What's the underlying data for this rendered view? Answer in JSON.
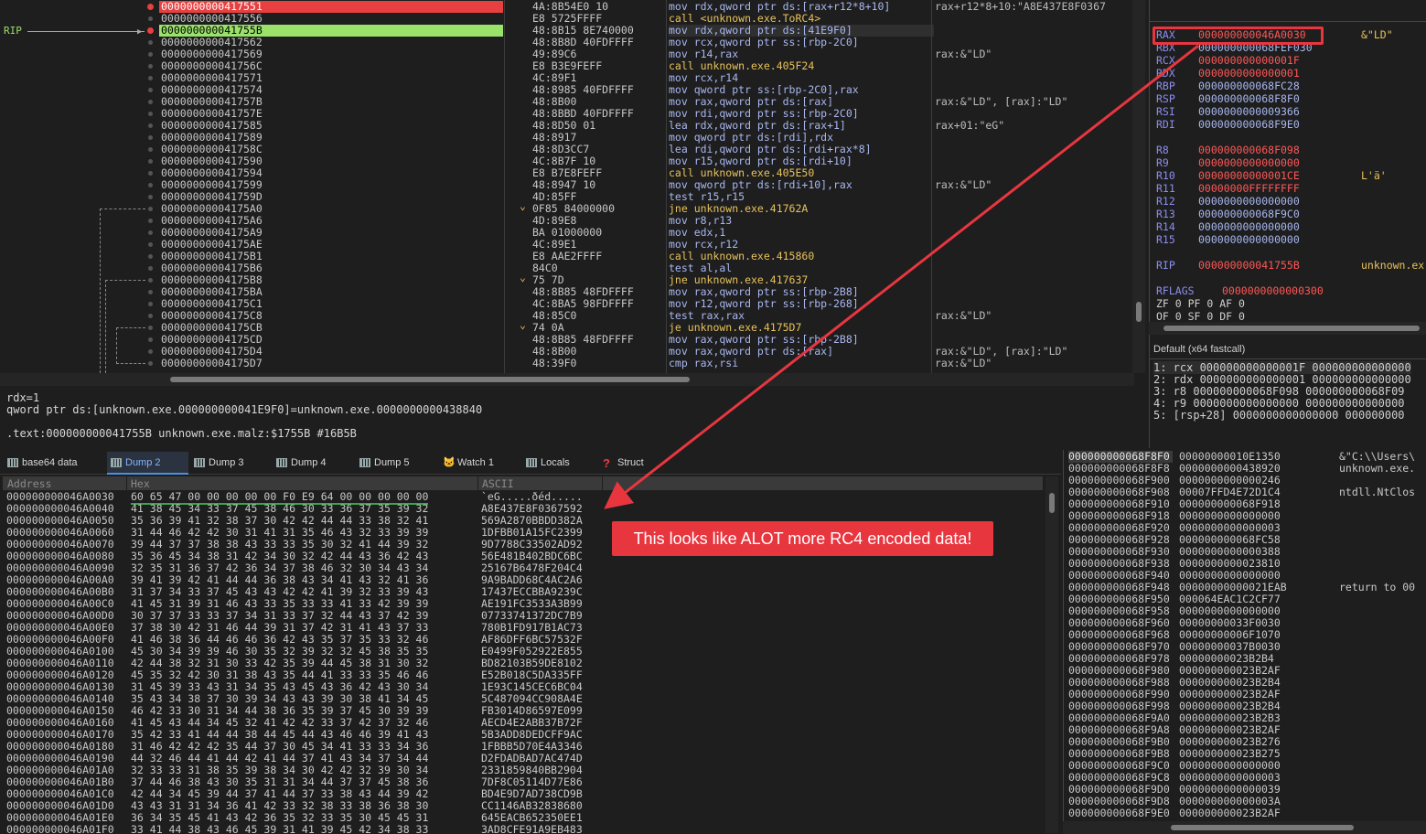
{
  "disasm": {
    "rip_label": "RIP",
    "rows": [
      {
        "addr": "0000000000417551",
        "bytes": "4A:8B54E0 10",
        "asm": "mov rdx,qword ptr ds:[rax+r12*8+10]",
        "comment": "rax+r12*8+10:\"A8E437E8F0367",
        "kind": "norm",
        "hl": "red"
      },
      {
        "addr": "0000000000417556",
        "bytes": "E8 5725FFFF",
        "asm": "call <unknown.exe.ToRC4>",
        "comment": "",
        "kind": "call"
      },
      {
        "addr": "000000000041755B",
        "bytes": "48:8B15 8E740000",
        "asm": "mov rdx,qword ptr ds:[41E9F0]",
        "comment": "",
        "kind": "norm",
        "hl": "green",
        "sel": true
      },
      {
        "addr": "0000000000417562",
        "bytes": "48:8B8D 40FDFFFF",
        "asm": "mov rcx,qword ptr ss:[rbp-2C0]",
        "comment": "",
        "kind": "norm"
      },
      {
        "addr": "0000000000417569",
        "bytes": "49:89C6",
        "asm": "mov r14,rax",
        "comment": "rax:&\"LD\"",
        "kind": "norm"
      },
      {
        "addr": "000000000041756C",
        "bytes": "E8 B3E9FEFF",
        "asm": "call unknown.exe.405F24",
        "comment": "",
        "kind": "call"
      },
      {
        "addr": "0000000000417571",
        "bytes": "4C:89F1",
        "asm": "mov rcx,r14",
        "comment": "",
        "kind": "norm"
      },
      {
        "addr": "0000000000417574",
        "bytes": "48:8985 40FDFFFF",
        "asm": "mov qword ptr ss:[rbp-2C0],rax",
        "comment": "",
        "kind": "norm"
      },
      {
        "addr": "000000000041757B",
        "bytes": "48:8B00",
        "asm": "mov rax,qword ptr ds:[rax]",
        "comment": "rax:&\"LD\", [rax]:\"LD\"",
        "kind": "norm"
      },
      {
        "addr": "000000000041757E",
        "bytes": "48:8BBD 40FDFFFF",
        "asm": "mov rdi,qword ptr ss:[rbp-2C0]",
        "comment": "",
        "kind": "norm"
      },
      {
        "addr": "0000000000417585",
        "bytes": "48:8D50 01",
        "asm": "lea rdx,qword ptr ds:[rax+1]",
        "comment": "rax+01:\"eG\"",
        "kind": "norm"
      },
      {
        "addr": "0000000000417589",
        "bytes": "48:8917",
        "asm": "mov qword ptr ds:[rdi],rdx",
        "comment": "",
        "kind": "norm"
      },
      {
        "addr": "000000000041758C",
        "bytes": "48:8D3CC7",
        "asm": "lea rdi,qword ptr ds:[rdi+rax*8]",
        "comment": "",
        "kind": "norm"
      },
      {
        "addr": "0000000000417590",
        "bytes": "4C:8B7F 10",
        "asm": "mov r15,qword ptr ds:[rdi+10]",
        "comment": "",
        "kind": "norm"
      },
      {
        "addr": "0000000000417594",
        "bytes": "E8 B7E8FEFF",
        "asm": "call unknown.exe.405E50",
        "comment": "",
        "kind": "call"
      },
      {
        "addr": "0000000000417599",
        "bytes": "48:8947 10",
        "asm": "mov qword ptr ds:[rdi+10],rax",
        "comment": "rax:&\"LD\"",
        "kind": "norm"
      },
      {
        "addr": "000000000041759D",
        "bytes": "4D:85FF",
        "asm": "test r15,r15",
        "comment": "",
        "kind": "norm"
      },
      {
        "addr": "00000000004175A0",
        "bytes": "0F85 84000000",
        "asm": "jne unknown.exe.41762A",
        "comment": "",
        "kind": "jmp",
        "mark": "v"
      },
      {
        "addr": "00000000004175A6",
        "bytes": "4D:89E8",
        "asm": "mov r8,r13",
        "comment": "",
        "kind": "norm"
      },
      {
        "addr": "00000000004175A9",
        "bytes": "BA 01000000",
        "asm": "mov edx,1",
        "comment": "",
        "kind": "norm"
      },
      {
        "addr": "00000000004175AE",
        "bytes": "4C:89E1",
        "asm": "mov rcx,r12",
        "comment": "",
        "kind": "norm"
      },
      {
        "addr": "00000000004175B1",
        "bytes": "E8 AAE2FFFF",
        "asm": "call unknown.exe.415860",
        "comment": "",
        "kind": "call"
      },
      {
        "addr": "00000000004175B6",
        "bytes": "84C0",
        "asm": "test al,al",
        "comment": "",
        "kind": "norm"
      },
      {
        "addr": "00000000004175B8",
        "bytes": "75 7D",
        "asm": "jne unknown.exe.417637",
        "comment": "",
        "kind": "jmp",
        "mark": "v"
      },
      {
        "addr": "00000000004175BA",
        "bytes": "48:8B85 48FDFFFF",
        "asm": "mov rax,qword ptr ss:[rbp-2B8]",
        "comment": "",
        "kind": "norm"
      },
      {
        "addr": "00000000004175C1",
        "bytes": "4C:8BA5 98FDFFFF",
        "asm": "mov r12,qword ptr ss:[rbp-268]",
        "comment": "",
        "kind": "norm"
      },
      {
        "addr": "00000000004175C8",
        "bytes": "48:85C0",
        "asm": "test rax,rax",
        "comment": "rax:&\"LD\"",
        "kind": "norm"
      },
      {
        "addr": "00000000004175CB",
        "bytes": "74 0A",
        "asm": "je unknown.exe.4175D7",
        "comment": "",
        "kind": "jmp",
        "mark": "v"
      },
      {
        "addr": "00000000004175CD",
        "bytes": "48:8B85 48FDFFFF",
        "asm": "mov rax,qword ptr ss:[rbp-2B8]",
        "comment": "",
        "kind": "norm"
      },
      {
        "addr": "00000000004175D4",
        "bytes": "48:8B00",
        "asm": "mov rax,qword ptr ds:[rax]",
        "comment": "rax:&\"LD\", [rax]:\"LD\"",
        "kind": "norm"
      },
      {
        "addr": "00000000004175D7",
        "bytes": "48:39F0",
        "asm": "cmp rax,rsi",
        "comment": "rax:&\"LD\"",
        "kind": "norm"
      }
    ]
  },
  "info": {
    "line1": "rdx=1",
    "line2": "qword ptr ds:[unknown.exe.000000000041E9F0]=unknown.exe.0000000000438840",
    "line3": ".text:000000000041755B unknown.exe.malz:$1755B #16B5B"
  },
  "registers": {
    "gp": [
      {
        "name": "RAX",
        "value": "000000000046A0030",
        "comment": "&\"LD\"",
        "changed": true
      },
      {
        "name": "RBX",
        "value": "000000000068FEF030",
        "comment": "",
        "changed": false
      },
      {
        "name": "RCX",
        "value": "000000000000001F",
        "comment": "",
        "changed": true
      },
      {
        "name": "RDX",
        "value": "0000000000000001",
        "comment": "",
        "changed": true
      },
      {
        "name": "RBP",
        "value": "000000000068FC28",
        "comment": "",
        "changed": false
      },
      {
        "name": "RSP",
        "value": "000000000068F8F0",
        "comment": "",
        "changed": false
      },
      {
        "name": "RSI",
        "value": "0000000000009366",
        "comment": "",
        "changed": false
      },
      {
        "name": "RDI",
        "value": "000000000068F9E0",
        "comment": "",
        "changed": false
      }
    ],
    "ext": [
      {
        "name": "R8",
        "value": "000000000068F098",
        "comment": "",
        "changed": true
      },
      {
        "name": "R9",
        "value": "0000000000000000",
        "comment": "",
        "changed": true
      },
      {
        "name": "R10",
        "value": "00000000000001CE",
        "comment": "L'ä'",
        "changed": true
      },
      {
        "name": "R11",
        "value": "00000000FFFFFFFF",
        "comment": "",
        "changed": true
      },
      {
        "name": "R12",
        "value": "0000000000000000",
        "comment": "",
        "changed": false
      },
      {
        "name": "R13",
        "value": "000000000068F9C0",
        "comment": "",
        "changed": false
      },
      {
        "name": "R14",
        "value": "0000000000000000",
        "comment": "",
        "changed": false
      },
      {
        "name": "R15",
        "value": "0000000000000000",
        "comment": "",
        "changed": false
      }
    ],
    "rip": {
      "name": "RIP",
      "value": "000000000041755B",
      "comment": "unknown.ex"
    },
    "rflags": {
      "name": "RFLAGS",
      "value": "0000000000000300"
    },
    "flags_row1": "ZF 0  PF 0  AF 0",
    "flags_row2": "OF 0  SF 0  DF 0"
  },
  "callconv": {
    "title": "Default (x64 fastcall)",
    "args": [
      "1: rcx 000000000000001F 000000000000000",
      "2: rdx 0000000000000001 000000000000000",
      "3: r8 000000000068F098 000000000068F09",
      "4: r9 0000000000000000 000000000000000",
      "5: [rsp+28] 0000000000000000 000000000"
    ]
  },
  "tabs": [
    {
      "label": "base64 data",
      "icon": "grid-icon"
    },
    {
      "label": "Dump 2",
      "icon": "grid-icon",
      "active": true
    },
    {
      "label": "Dump 3",
      "icon": "grid-icon"
    },
    {
      "label": "Dump 4",
      "icon": "grid-icon"
    },
    {
      "label": "Dump 5",
      "icon": "grid-icon"
    },
    {
      "label": "Watch 1",
      "icon": "cat-icon"
    },
    {
      "label": "Locals",
      "icon": "locals-icon"
    },
    {
      "label": "Struct",
      "icon": "struct-icon"
    }
  ],
  "dump": {
    "headers": {
      "address": "Address",
      "hex": "Hex",
      "ascii": "ASCII"
    },
    "rows": [
      {
        "a": "000000000046A0030",
        "h": "60 65 47 00 00 00 00 00  F0 E9 64 00 00 00 00 00",
        "s": "`eG.....ðéd....."
      },
      {
        "a": "000000000046A0040",
        "h": "41 38 45 34 33 37 45 38  46 30 33 36 37 35 39 32",
        "s": "A8E437E8F0367592"
      },
      {
        "a": "000000000046A0050",
        "h": "35 36 39 41 32 38 37 30  42 42 44 44 33 38 32 41",
        "s": "569A2870BBDD382A"
      },
      {
        "a": "000000000046A0060",
        "h": "31 44 46 42 42 30 31 41  31 35 46 43 32 33 39 39",
        "s": "1DFBB01A15FC2399"
      },
      {
        "a": "000000000046A0070",
        "h": "39 44 37 37 38 38 43 33  33 35 30 32 41 44 39 32",
        "s": "9D7788C33502AD92"
      },
      {
        "a": "000000000046A0080",
        "h": "35 36 45 34 38 31 42 34  30 32 42 44 43 36 42 43",
        "s": "56E481B402BDC6BC"
      },
      {
        "a": "000000000046A0090",
        "h": "32 35 31 36 37 42 36 34  37 38 46 32 30 34 43 34",
        "s": "25167B6478F204C4"
      },
      {
        "a": "000000000046A00A0",
        "h": "39 41 39 42 41 44 44 36  38 43 34 41 43 32 41 36",
        "s": "9A9BADD68C4AC2A6"
      },
      {
        "a": "000000000046A00B0",
        "h": "31 37 34 33 37 45 43 43  42 42 41 39 32 33 39 43",
        "s": "17437ECCBBA9239C"
      },
      {
        "a": "000000000046A00C0",
        "h": "41 45 31 39 31 46 43 33  35 33 33 41 33 42 39 39",
        "s": "AE191FC3533A3B99"
      },
      {
        "a": "000000000046A00D0",
        "h": "30 37 37 33 33 37 34 31  33 37 32 44 43 37 42 39",
        "s": "07733741372DC7B9"
      },
      {
        "a": "000000000046A00E0",
        "h": "37 38 30 42 31 46 44 39  31 37 42 31 41 43 37 33",
        "s": "780B1FD917B1AC73"
      },
      {
        "a": "000000000046A00F0",
        "h": "41 46 38 36 44 46 46 36  42 43 35 37 35 33 32 46",
        "s": "AF86DFF6BC57532F"
      },
      {
        "a": "000000000046A0100",
        "h": "45 30 34 39 39 46 30 35  32 39 32 32 45 38 35 35",
        "s": "E0499F052922E855"
      },
      {
        "a": "000000000046A0110",
        "h": "42 44 38 32 31 30 33 42  35 39 44 45 38 31 30 32",
        "s": "BD82103B59DE8102"
      },
      {
        "a": "000000000046A0120",
        "h": "45 35 32 42 30 31 38 43  35 44 41 33 33 35 46 46",
        "s": "E52B018C5DA335FF"
      },
      {
        "a": "000000000046A0130",
        "h": "31 45 39 33 43 31 34 35  43 45 43 36 42 43 30 34",
        "s": "1E93C145CEC6BC04"
      },
      {
        "a": "000000000046A0140",
        "h": "35 43 34 38 37 30 39 34  43 43 39 30 38 41 34 45",
        "s": "5C487094CC908A4E"
      },
      {
        "a": "000000000046A0150",
        "h": "46 42 33 30 31 34 44 38  36 35 39 37 45 30 39 39",
        "s": "FB3014D86597E099"
      },
      {
        "a": "000000000046A0160",
        "h": "41 45 43 44 34 45 32 41  42 42 33 37 42 37 32 46",
        "s": "AECD4E2ABB37B72F"
      },
      {
        "a": "000000000046A0170",
        "h": "35 42 33 41 44 44 38 44  45 44 43 46 46 39 41 43",
        "s": "5B3ADD8DEDCFF9AC"
      },
      {
        "a": "000000000046A0180",
        "h": "31 46 42 42 42 35 44 37  30 45 34 41 33 33 34 36",
        "s": "1FBBB5D70E4A3346"
      },
      {
        "a": "000000000046A0190",
        "h": "44 32 46 44 41 44 42 41  44 37 41 43 34 37 34 44",
        "s": "D2FDADBAD7AC474D"
      },
      {
        "a": "000000000046A01A0",
        "h": "32 33 33 31 38 35 39 38  34 30 42 42 32 39 30 34",
        "s": "2331859840BB2904"
      },
      {
        "a": "000000000046A01B0",
        "h": "37 44 46 38 43 30 35 31  31 34 44 37 37 45 38 36",
        "s": "7DF8C05114D77E86"
      },
      {
        "a": "000000000046A01C0",
        "h": "42 44 34 45 39 44 37 41  44 37 33 38 43 44 39 42",
        "s": "BD4E9D7AD738CD9B"
      },
      {
        "a": "000000000046A01D0",
        "h": "43 43 31 31 34 36 41 42  33 32 38 33 38 36 38 30",
        "s": "CC1146AB32838680"
      },
      {
        "a": "000000000046A01E0",
        "h": "36 34 35 45 41 43 42 36  35 32 33 35 30 45 45 31",
        "s": "645EACB652350EE1"
      },
      {
        "a": "000000000046A01F0",
        "h": "33 41 44 38 43 46 45 39  31 41 39 45 42 34 38 33",
        "s": "3AD8CFE91A9EB483"
      }
    ]
  },
  "stack": {
    "rows": [
      {
        "a": "000000000068F8F0",
        "v": "00000000010E1350",
        "c": "&\"C:\\\\Users\\"
      },
      {
        "a": "000000000068F8F8",
        "v": "0000000000438920",
        "c": "unknown.exe."
      },
      {
        "a": "000000000068F900",
        "v": "0000000000000246",
        "c": ""
      },
      {
        "a": "000000000068F908",
        "v": "00007FFD4E72D1C4",
        "c": "ntdll.NtClos"
      },
      {
        "a": "000000000068F910",
        "v": "000000000068F918",
        "c": ""
      },
      {
        "a": "000000000068F918",
        "v": "0000000000000000",
        "c": ""
      },
      {
        "a": "000000000068F920",
        "v": "0000000000000003",
        "c": ""
      },
      {
        "a": "000000000068F928",
        "v": "000000000068FC58",
        "c": ""
      },
      {
        "a": "000000000068F930",
        "v": "0000000000000388",
        "c": ""
      },
      {
        "a": "000000000068F938",
        "v": "0000000000023810",
        "c": ""
      },
      {
        "a": "000000000068F940",
        "v": "0000000000000000",
        "c": ""
      },
      {
        "a": "000000000068F948",
        "v": "00000000000021EAB",
        "c": "return to 00"
      },
      {
        "a": "000000000068F950",
        "v": "000064EAC1C2CF77",
        "c": ""
      },
      {
        "a": "000000000068F958",
        "v": "0000000000000000",
        "c": ""
      },
      {
        "a": "000000000068F960",
        "v": "00000000033F0030",
        "c": ""
      },
      {
        "a": "000000000068F968",
        "v": "00000000006F1070",
        "c": ""
      },
      {
        "a": "000000000068F970",
        "v": "00000000037B0030",
        "c": ""
      },
      {
        "a": "000000000068F978",
        "v": "00000000023B2B4",
        "c": ""
      },
      {
        "a": "000000000068F980",
        "v": "000000000023B2AF",
        "c": ""
      },
      {
        "a": "000000000068F988",
        "v": "000000000023B2B4",
        "c": ""
      },
      {
        "a": "000000000068F990",
        "v": "000000000023B2AF",
        "c": ""
      },
      {
        "a": "000000000068F998",
        "v": "000000000023B2B4",
        "c": ""
      },
      {
        "a": "000000000068F9A0",
        "v": "000000000023B2B3",
        "c": ""
      },
      {
        "a": "000000000068F9A8",
        "v": "000000000023B2AF",
        "c": ""
      },
      {
        "a": "000000000068F9B0",
        "v": "000000000023B276",
        "c": ""
      },
      {
        "a": "000000000068F9B8",
        "v": "000000000023B275",
        "c": ""
      },
      {
        "a": "000000000068F9C0",
        "v": "0000000000000000",
        "c": ""
      },
      {
        "a": "000000000068F9C8",
        "v": "0000000000000003",
        "c": ""
      },
      {
        "a": "000000000068F9D0",
        "v": "0000000000000039",
        "c": ""
      },
      {
        "a": "000000000068F9D8",
        "v": "000000000000003A",
        "c": ""
      },
      {
        "a": "000000000068F9E0",
        "v": "000000000023B2AF",
        "c": ""
      }
    ]
  },
  "annotation": {
    "callout": "This looks like ALOT more RC4 encoded data!",
    "color": "#e8363f"
  }
}
